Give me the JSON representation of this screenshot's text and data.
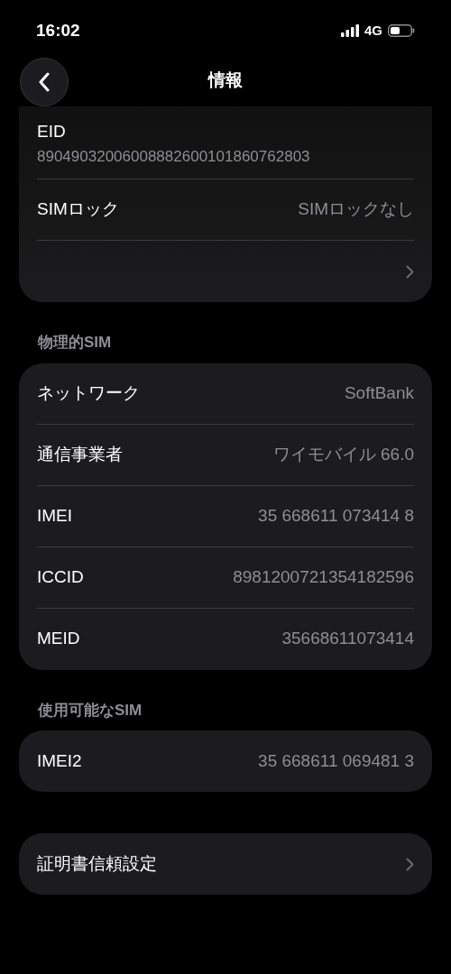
{
  "status_bar": {
    "time": "16:02",
    "network": "4G"
  },
  "nav": {
    "title": "情報"
  },
  "top_card": {
    "rows": [
      {
        "kind": "stacked",
        "label": "EID",
        "value": "89049032006008882600101860762803"
      },
      {
        "kind": "inline",
        "label": "SIMロック",
        "value": "SIMロックなし"
      },
      {
        "kind": "link"
      }
    ]
  },
  "sections": [
    {
      "header": "物理的SIM",
      "rows": [
        {
          "kind": "inline",
          "label": "ネットワーク",
          "value": "SoftBank"
        },
        {
          "kind": "inline",
          "label": "通信事業者",
          "value": "ワイモバイル 66.0"
        },
        {
          "kind": "inline",
          "label": "IMEI",
          "value": "35 668611 073414 8"
        },
        {
          "kind": "inline",
          "label": "ICCID",
          "value": "8981200721354182596"
        },
        {
          "kind": "inline",
          "label": "MEID",
          "value": "35668611073414"
        }
      ]
    },
    {
      "header": "使用可能なSIM",
      "rows": [
        {
          "kind": "inline",
          "label": "IMEI2",
          "value": "35 668611 069481 3"
        }
      ]
    },
    {
      "rows": [
        {
          "kind": "link",
          "label": "証明書信頼設定"
        }
      ]
    }
  ]
}
